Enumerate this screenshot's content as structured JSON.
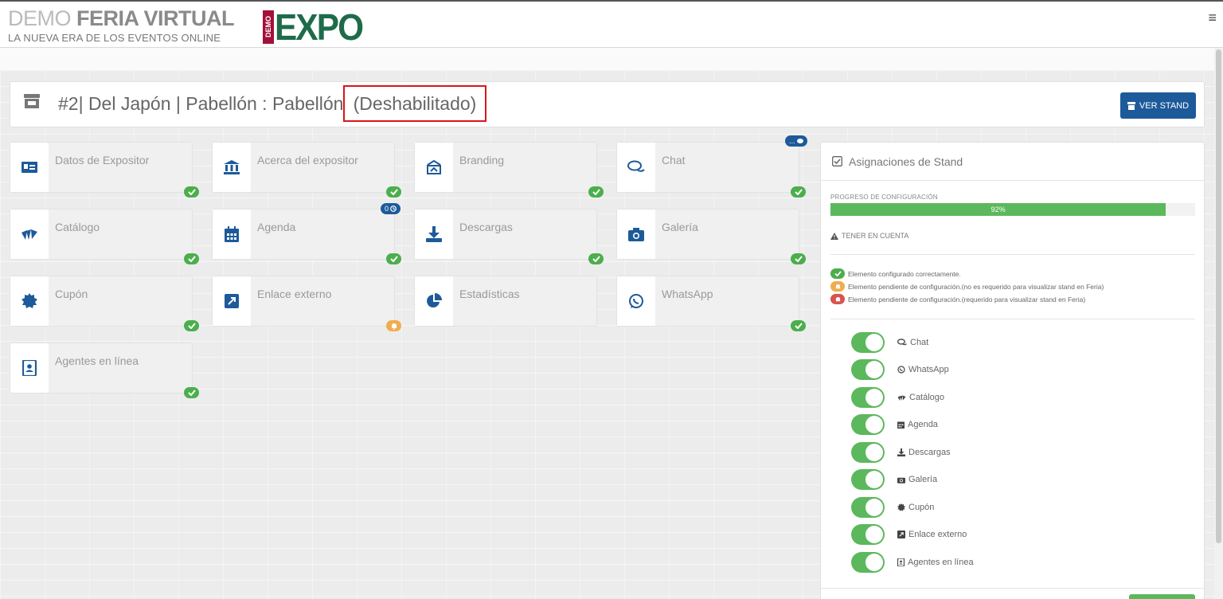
{
  "header": {
    "brand_light": "DEMO",
    "brand_bold": "FERIA VIRTUAL",
    "brand_sub": "LA NUEVA ERA DE LOS EVENTOS ONLINE",
    "logo_demo": "DEMO",
    "logo_expo": "EXPO",
    "menu_icon": "hamburger-icon"
  },
  "stand": {
    "title": "#2| Del Japón | Pabellón : Pabellón",
    "status": "(Deshabilitado)",
    "view_button": "VER STAND"
  },
  "tiles": [
    {
      "label": "Datos de Expositor",
      "icon": "id-card-icon",
      "status": "ok"
    },
    {
      "label": "Acerca del expositor",
      "icon": "bank-icon",
      "status": "ok"
    },
    {
      "label": "Branding",
      "icon": "branding-icon",
      "status": "ok"
    },
    {
      "label": "Chat",
      "icon": "chat-icon",
      "status": "ok",
      "count": "..."
    },
    {
      "label": "Catálogo",
      "icon": "catalog-icon",
      "status": "ok"
    },
    {
      "label": "Agenda",
      "icon": "calendar-icon",
      "status": "ok",
      "count": "0"
    },
    {
      "label": "Descargas",
      "icon": "download-icon",
      "status": "ok"
    },
    {
      "label": "Galería",
      "icon": "camera-icon",
      "status": "ok"
    },
    {
      "label": "Cupón",
      "icon": "coupon-icon",
      "status": "ok"
    },
    {
      "label": "Enlace externo",
      "icon": "external-link-icon",
      "status": "warn"
    },
    {
      "label": "Estadísticas",
      "icon": "pie-chart-icon",
      "status": "none"
    },
    {
      "label": "WhatsApp",
      "icon": "whatsapp-icon",
      "status": "ok"
    },
    {
      "label": "Agentes en línea",
      "icon": "contact-book-icon",
      "status": "ok"
    }
  ],
  "panel": {
    "title": "Asignaciones de Stand",
    "progress_label": "PROGRESO DE CONFIGURACIÓN",
    "progress_value": 0.92,
    "progress_text": "92%",
    "note_title": "TENER EN CUENTA",
    "legend": [
      {
        "text": "Elemento configurado correctamente.",
        "color": "#4cae4c"
      },
      {
        "text": "Elemento pendiente de configuración.(no es requerido para visualizar stand en Feria)",
        "color": "#f0ad4e"
      },
      {
        "text": "Elemento pendiente de configuración.(requerido para visualizar stand en Feria)",
        "color": "#d9534f"
      }
    ],
    "toggles": [
      {
        "label": "Chat",
        "icon": "chat-icon",
        "on": true
      },
      {
        "label": "WhatsApp",
        "icon": "whatsapp-icon",
        "on": true
      },
      {
        "label": "Catálogo",
        "icon": "catalog-icon",
        "on": true
      },
      {
        "label": "Agenda",
        "icon": "calendar-icon",
        "on": true
      },
      {
        "label": "Descargas",
        "icon": "download-icon",
        "on": true
      },
      {
        "label": "Galería",
        "icon": "camera-icon",
        "on": true
      },
      {
        "label": "Cupón",
        "icon": "coupon-icon",
        "on": true
      },
      {
        "label": "Enlace externo",
        "icon": "external-link-icon",
        "on": true
      },
      {
        "label": "Agentes en línea",
        "icon": "contact-book-icon",
        "on": true
      }
    ]
  },
  "colors": {
    "primary": "#1d5a9a",
    "success": "#4cae4c",
    "warning": "#f0ad4e",
    "danger": "#d9534f",
    "highlight_border": "#d9161b",
    "logo_green": "#1e6b4a",
    "logo_red": "#a3103a"
  }
}
